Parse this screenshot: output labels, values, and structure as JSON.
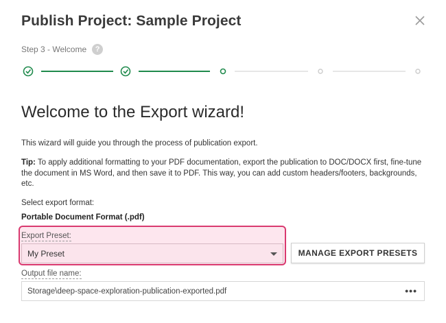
{
  "dialog": {
    "title": "Publish Project: Sample Project",
    "close_icon": "close-icon"
  },
  "step": {
    "label": "Step 3 - Welcome",
    "help_glyph": "?",
    "total": 5,
    "current": 3,
    "completed_color": "#1f8a4c",
    "inactive_color": "#cccccc"
  },
  "content": {
    "heading": "Welcome to the Export wizard!",
    "intro": "This wizard will guide you through the process of publication export.",
    "tip_label": "Tip:",
    "tip_text": " To apply additional formatting to your PDF documentation, export the publication to DOC/DOCX first, fine-tune the document in MS Word, and then save it to PDF. This way, you can add custom headers/footers, backgrounds, etc.",
    "format_label": "Select export format:",
    "format_value": "Portable Document Format (.pdf)",
    "preset_label": "Export Preset:",
    "preset_value": "My Preset",
    "manage_button": "MANAGE EXPORT PRESETS",
    "output_label": "Output file name:",
    "output_value": "Storage\\deep-space-exploration-publication-exported.pdf",
    "browse_glyph": "•••",
    "highlight_color": "#d9396f"
  }
}
